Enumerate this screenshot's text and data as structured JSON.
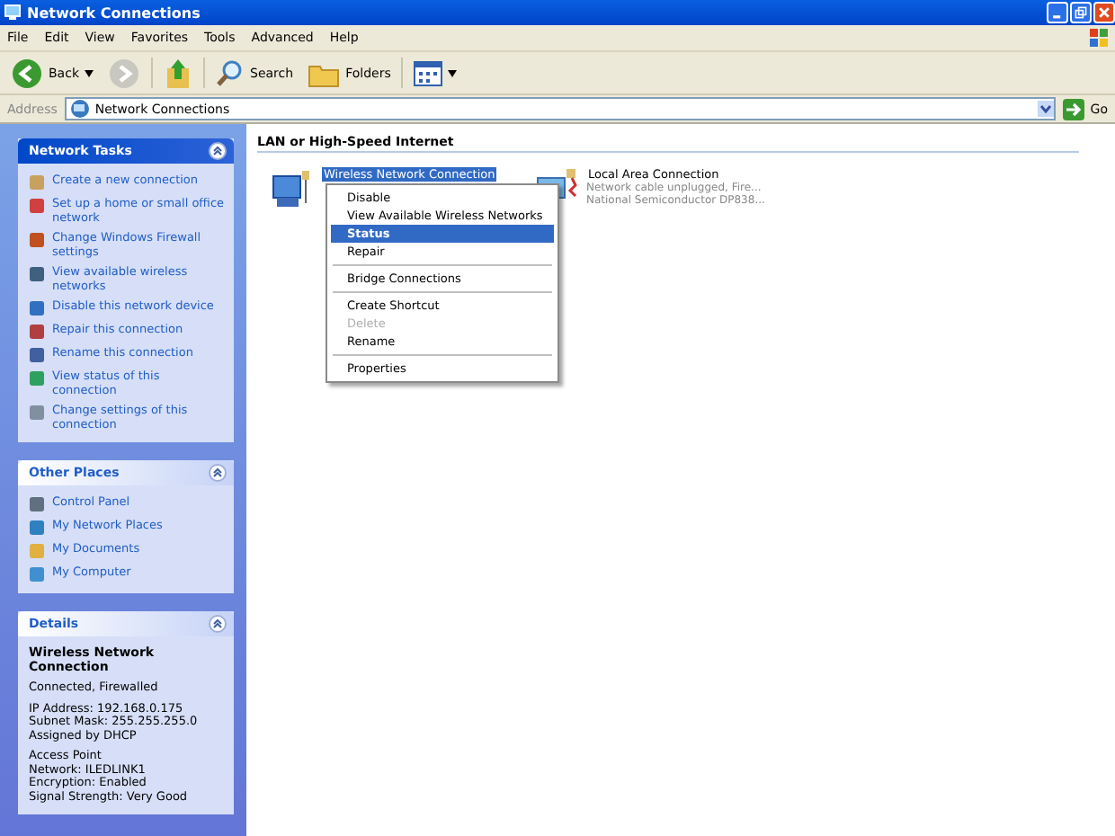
{
  "window": {
    "title": "Network Connections"
  },
  "menu_bar": [
    "File",
    "Edit",
    "View",
    "Favorites",
    "Tools",
    "Advanced",
    "Help"
  ],
  "toolbar": [
    {
      "kind": "back",
      "label": "Back"
    },
    {
      "kind": "forward"
    },
    {
      "kind": "up"
    },
    {
      "kind": "search",
      "label": "Search"
    },
    {
      "kind": "folders",
      "label": "Folders"
    },
    {
      "kind": "views"
    }
  ],
  "address_bar": {
    "label": "Address",
    "value": "Network Connections",
    "go": "Go"
  },
  "network_tasks": {
    "title": "Network Tasks",
    "items": [
      {
        "label": "Create a new connection"
      },
      {
        "label": "Set up a home or small office network"
      },
      {
        "label": "Change Windows Firewall settings"
      },
      {
        "label": "View available wireless networks"
      },
      {
        "label": "Disable this network device"
      },
      {
        "label": "Repair this connection"
      },
      {
        "label": "Rename this connection"
      },
      {
        "label": "View status of this connection"
      },
      {
        "label": "Change settings of this connection"
      }
    ]
  },
  "other_places": {
    "title": "Other Places",
    "items": [
      {
        "label": "Control Panel"
      },
      {
        "label": "My Network Places"
      },
      {
        "label": "My Documents"
      },
      {
        "label": "My Computer"
      }
    ]
  },
  "details": {
    "title": "Details",
    "name": "Wireless Network Connection",
    "groups": [
      [
        "Connected, Firewalled"
      ],
      [
        "IP Address: 192.168.0.175",
        "Subnet Mask: 255.255.255.0",
        "Assigned by DHCP"
      ],
      [
        "Access Point",
        "Network: ILEDLINK1",
        "Encryption: Enabled",
        "Signal Strength: Very Good"
      ]
    ]
  },
  "group_heading": "LAN or High-Speed Internet",
  "connections": [
    {
      "kind": "wireless",
      "name": "Wireless Network Connection",
      "selected": true
    },
    {
      "kind": "lan",
      "name": "Local Area Connection",
      "selected": false,
      "lines": [
        "Network cable unplugged, Fire...",
        "National Semiconductor DP838..."
      ]
    }
  ],
  "context_menu": [
    [
      {
        "label": "Disable",
        "selected": false,
        "disabled": false
      },
      {
        "label": "View Available Wireless Networks",
        "selected": false,
        "disabled": false
      },
      {
        "label": "Status",
        "selected": true,
        "disabled": false
      },
      {
        "label": "Repair",
        "selected": false,
        "disabled": false
      }
    ],
    [
      {
        "label": "Bridge Connections",
        "selected": false,
        "disabled": false
      }
    ],
    [
      {
        "label": "Create Shortcut",
        "selected": false,
        "disabled": false
      },
      {
        "label": "Delete",
        "selected": false,
        "disabled": true
      },
      {
        "label": "Rename",
        "selected": false,
        "disabled": false
      }
    ],
    [
      {
        "label": "Properties",
        "selected": false,
        "disabled": false
      }
    ]
  ]
}
